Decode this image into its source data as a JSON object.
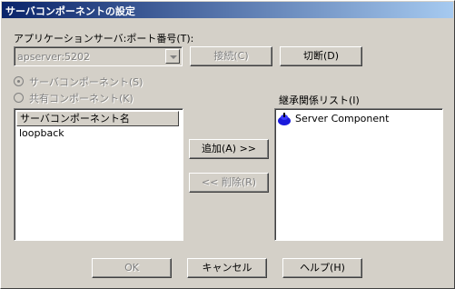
{
  "window": {
    "title": "サーバコンポーネントの設定"
  },
  "port": {
    "label": "アプリケーションサーバ:ポート番号(T):",
    "value": "apserver:5202",
    "connect_label": "接続(C)",
    "disconnect_label": "切断(D)"
  },
  "radios": [
    {
      "label": "サーバコンポーネント(S)",
      "selected": true
    },
    {
      "label": "共有コンポーネント(K)",
      "selected": false
    }
  ],
  "left_list": {
    "header": "サーバコンポーネント名",
    "items": [
      "loopback"
    ]
  },
  "middle": {
    "add_label": "追加(A) >>",
    "remove_label": "<< 削除(R)"
  },
  "right_list": {
    "label": "継承関係リスト(I)",
    "items": [
      "Server Component"
    ]
  },
  "footer": {
    "ok_label": "OK",
    "cancel_label": "キャンセル",
    "help_label": "ヘルプ(H)"
  }
}
